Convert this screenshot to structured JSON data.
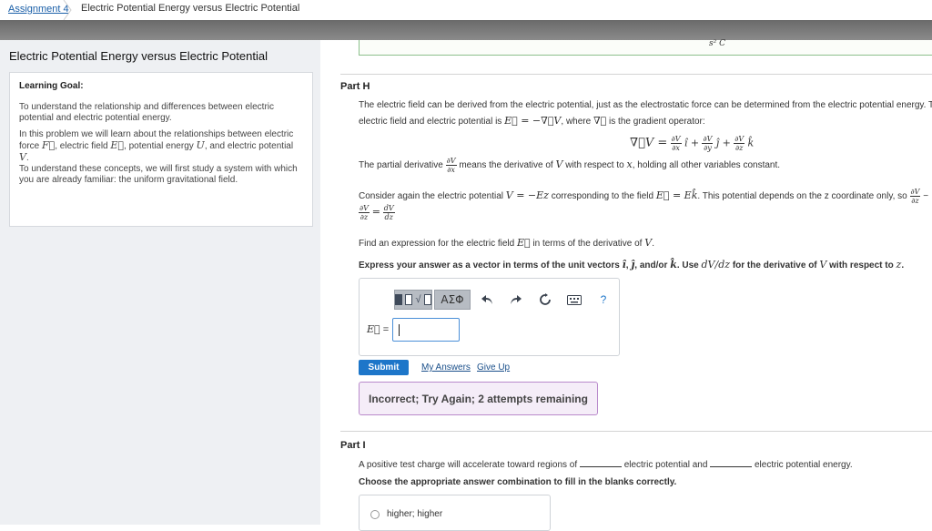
{
  "breadcrumb": {
    "assignment": "Assignment 4",
    "title": "Electric Potential Energy versus Electric Potential"
  },
  "left": {
    "title": "Electric Potential Energy versus Electric Potential",
    "goal_heading": "Learning Goal:",
    "goal_p1": "To understand the relationship and differences between electric potential and electric potential energy.",
    "goal_p2_a": "In this problem we will learn about the relationships between electric force",
    "goal_p2_b": ", electric field",
    "goal_p2_c": ", potential energy",
    "goal_p2_d": ", and electric potential",
    "goal_p3": "To understand these concepts, we will first study a system with which you are already familiar: the uniform gravitational field."
  },
  "prev_part": {
    "unit": "s² C"
  },
  "partH": {
    "label": "Part H",
    "line1": "The electric field can be derived from the electric potential, just as the electrostatic force can be determined from the electric potential energy. T",
    "line2_a": "electric field and electric potential is",
    "line2_b": ", where",
    "line2_c": "is the gradient operator:",
    "partial_a": "The partial derivative",
    "partial_b": "means the derivative of",
    "partial_c": "with respect to",
    "partial_d": ", holding all other variables constant.",
    "consider_a": "Consider again the electric potential",
    "consider_b": "corresponding to the field",
    "consider_c": ". This potential depends on the z coordinate only, so",
    "find": "Find an expression for the electric field",
    "find_b": "in terms of the derivative of",
    "express_a": "Express your answer as a vector in terms of the unit vectors",
    "express_b": ", and/or",
    "express_c": ". Use",
    "express_d": "for the derivative of",
    "express_e": "with respect to",
    "answer_label": "=",
    "answer_value": "",
    "toolbar": {
      "template_icon": "template-sqrt-icon",
      "greek_label": "ΑΣΦ",
      "undo_icon": "undo-icon",
      "redo_icon": "redo-icon",
      "reset_icon": "reset-icon",
      "keyboard_icon": "keyboard-icon",
      "help_label": "?"
    },
    "submit_label": "Submit",
    "my_answers_label": "My Answers",
    "give_up_label": "Give Up",
    "feedback": "Incorrect; Try Again; 2 attempts remaining"
  },
  "partI": {
    "label": "Part I",
    "sentence_a": "A positive test charge will accelerate toward regions of",
    "sentence_b": "electric potential and",
    "sentence_c": "electric potential energy.",
    "instruction": "Choose the appropriate answer combination to fill in the blanks correctly.",
    "choice1": "higher; higher"
  },
  "colors": {
    "link": "#1a5fa8",
    "submit": "#1d76c9",
    "feedback_bg": "#f5edf8",
    "feedback_border": "#b98acb",
    "left_bg": "#eef0f3"
  }
}
